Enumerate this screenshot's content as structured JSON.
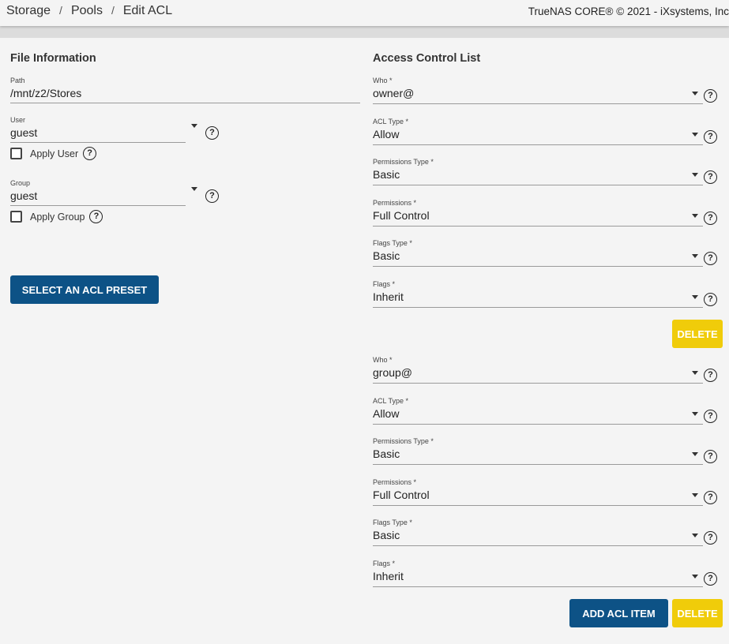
{
  "header": {
    "breadcrumbs": [
      "Storage",
      "Pools",
      "Edit ACL"
    ],
    "copyright": "TrueNAS CORE® © 2021 - iXsystems, Inc"
  },
  "file_info": {
    "title": "File Information",
    "path_label": "Path",
    "path_value": "/mnt/z2/Stores",
    "user_label": "User",
    "user_value": "guest",
    "apply_user_label": "Apply User",
    "group_label": "Group",
    "group_value": "guest",
    "apply_group_label": "Apply Group",
    "preset_button": "SELECT AN ACL PRESET"
  },
  "acl": {
    "title": "Access Control List",
    "items": [
      {
        "who_label": "Who *",
        "who": "owner@",
        "acl_type_label": "ACL Type *",
        "acl_type": "Allow",
        "perm_type_label": "Permissions Type *",
        "perm_type": "Basic",
        "perms_label": "Permissions *",
        "perms": "Full Control",
        "flags_type_label": "Flags Type *",
        "flags_type": "Basic",
        "flags_label": "Flags *",
        "flags": "Inherit",
        "delete_label": "DELETE"
      },
      {
        "who_label": "Who *",
        "who": "group@",
        "acl_type_label": "ACL Type *",
        "acl_type": "Allow",
        "perm_type_label": "Permissions Type *",
        "perm_type": "Basic",
        "perms_label": "Permissions *",
        "perms": "Full Control",
        "flags_type_label": "Flags Type *",
        "flags_type": "Basic",
        "flags_label": "Flags *",
        "flags": "Inherit",
        "delete_label": "DELETE"
      }
    ],
    "add_button": "ADD ACL ITEM"
  },
  "icons": {
    "help": "help-circle-icon",
    "dropdown": "caret-down-icon"
  },
  "colors": {
    "primary": "#0d5286",
    "warn": "#f0cc0a"
  }
}
